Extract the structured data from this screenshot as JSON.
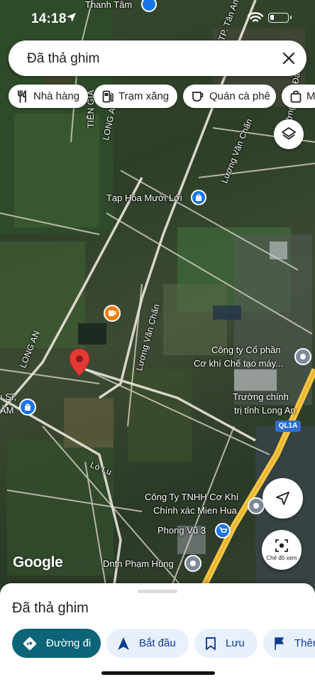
{
  "status_bar": {
    "time": "14:18"
  },
  "search": {
    "query": "Đã thả ghim"
  },
  "chips": [
    {
      "label": "Nhà hàng",
      "icon": "restaurant-icon"
    },
    {
      "label": "Trạm xăng",
      "icon": "gas-station-icon"
    },
    {
      "label": "Quán cà phê",
      "icon": "coffee-icon"
    },
    {
      "label": "M",
      "icon": "shopping-bag-icon"
    }
  ],
  "map": {
    "labels": {
      "thanh_tam": "Thanh Tâm",
      "tap_hoa": "Tạp Hóa Mười Lới",
      "cong_ty_co_phan_1": "Công ty Cổ phần",
      "cong_ty_co_phan_2": "Cơ khí Chế tạo máy...",
      "truong_chinh_tri_1": "Trường chính",
      "truong_chinh_tri_2": "trị tỉnh Long An",
      "cong_ty_tnhh_1": "Công Ty TNHH Cơ Khí",
      "cong_ty_tnhh_2": "Chính xác Mien Hua",
      "phong_vu": "Phong Vũ 3",
      "dntn": "Dntn Phạm Hùng",
      "si_lam_1": "ı Sĩ,",
      "si_lam_2": "ÂM",
      "road_luong_van_chan_1": "Lương Văn Chấn",
      "road_luong_van_chan_2": "Lương Văn Chấn",
      "road_long_an_1": "LONG AN",
      "road_long_an_2": "LONG AN",
      "road_tien_gia": "TIỀN GIA",
      "road_lo_lu": "Lò Lu",
      "road_tp_tan_an": "TP. Tân An",
      "road_duong_son_dan": "Đường Sơn Đan",
      "ql1a": "QL1A"
    },
    "attribution": "Google",
    "colors": {
      "dropped_pin": "#e53935",
      "poi_blue": "#1a73e8",
      "poi_orange": "#f57c00",
      "poi_gray": "#7c8a99",
      "highway": "#f5c542"
    }
  },
  "view_mode_button": {
    "label": "Chế độ xem"
  },
  "bottom_sheet": {
    "title": "Đã thả ghim",
    "actions": [
      {
        "label": "Đường đi",
        "icon": "directions-icon"
      },
      {
        "label": "Bắt đầu",
        "icon": "navigation-arrow-icon"
      },
      {
        "label": "Lưu",
        "icon": "bookmark-icon"
      },
      {
        "label": "Thêm",
        "icon": "flag-icon"
      }
    ]
  }
}
